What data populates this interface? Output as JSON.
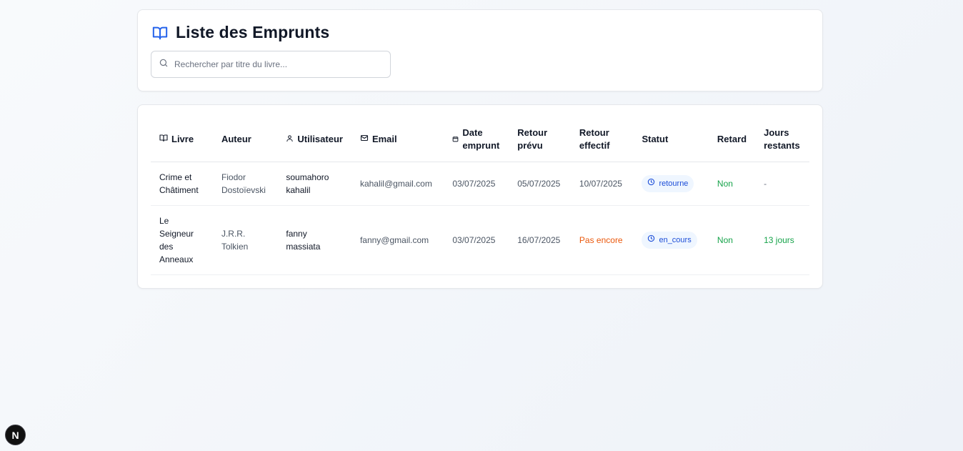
{
  "header": {
    "title": "Liste des Emprunts",
    "search_placeholder": "Rechercher par titre du livre..."
  },
  "table": {
    "columns": {
      "livre": "Livre",
      "auteur": "Auteur",
      "utilisateur": "Utilisateur",
      "email": "Email",
      "date_emprunt": "Date emprunt",
      "retour_prevu": "Retour prévu",
      "retour_effectif": "Retour effectif",
      "statut": "Statut",
      "retard": "Retard",
      "jours_restants": "Jours restants"
    },
    "rows": [
      {
        "livre": "Crime et Châtiment",
        "auteur": "Fiodor Dostoïevski",
        "utilisateur": "soumahoro kahalil",
        "email": "kahalil@gmail.com",
        "date_emprunt": "03/07/2025",
        "retour_prevu": "05/07/2025",
        "retour_effectif": "10/07/2025",
        "statut": "retourne",
        "retard": "Non",
        "jours_restants": "-"
      },
      {
        "livre": "Le Seigneur des Anneaux",
        "auteur": "J.R.R. Tolkien",
        "utilisateur": "fanny massiata",
        "email": "fanny@gmail.com",
        "date_emprunt": "03/07/2025",
        "retour_prevu": "16/07/2025",
        "retour_effectif": "Pas encore",
        "statut": "en_cours",
        "retard": "Non",
        "jours_restants": "13 jours"
      }
    ]
  },
  "dev_badge": {
    "label": "N"
  },
  "colors": {
    "accent": "#2563eb",
    "orange": "#ea580c",
    "green": "#16a34a",
    "badge_bg": "#eff6ff"
  }
}
